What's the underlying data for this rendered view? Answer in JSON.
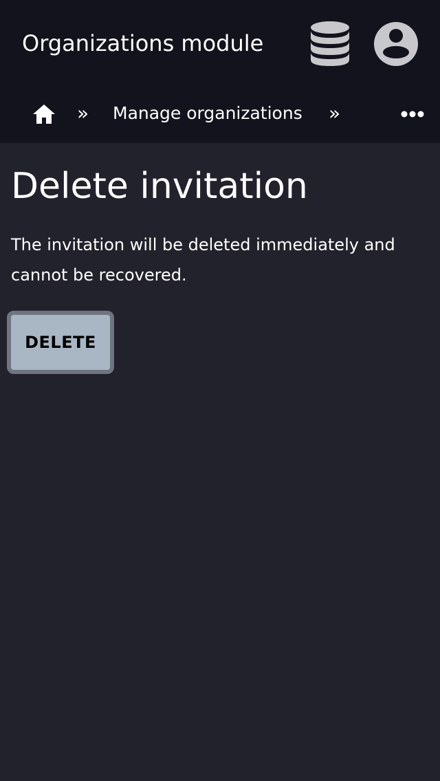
{
  "header": {
    "title": "Organizations module",
    "icons": {
      "database": "database-icon",
      "user": "user-account-icon"
    }
  },
  "breadcrumb": {
    "home_icon": "home-icon",
    "separator": "»",
    "items": [
      {
        "label": "Manage organizations"
      }
    ],
    "more_icon": "more-horizontal-icon"
  },
  "main": {
    "title": "Delete invitation",
    "description": "The invitation will be deleted immediately and cannot be recovered.",
    "delete_label": "DELETE"
  },
  "colors": {
    "header_bg": "#13131e",
    "page_bg": "#22222c",
    "button_bg": "#a9b6c3",
    "button_border": "#6e7581",
    "icon_gray": "#c8c8cc"
  }
}
